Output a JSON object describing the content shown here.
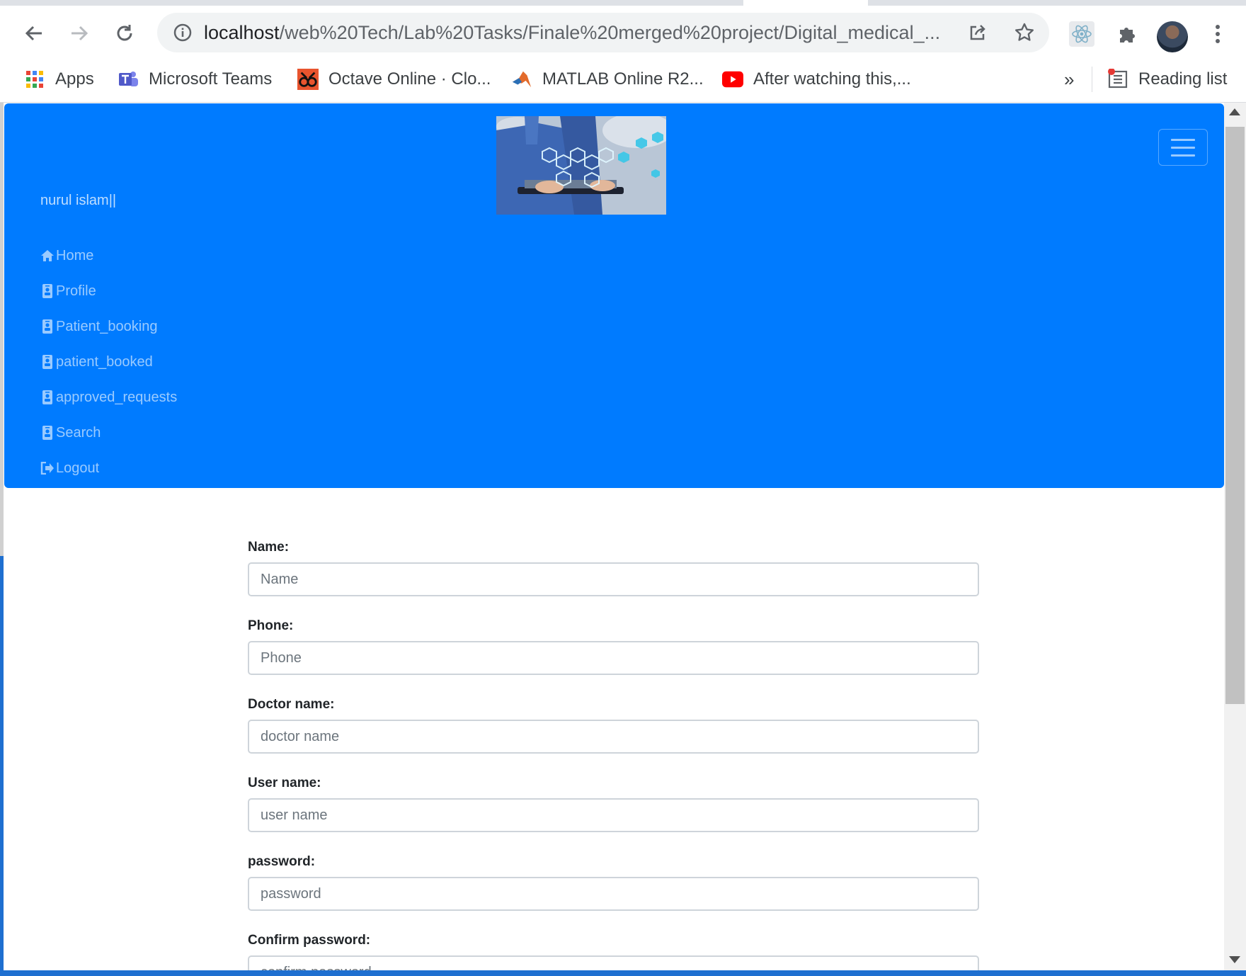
{
  "browser": {
    "url_host": "localhost",
    "url_path": "/web%20Tech/Lab%20Tasks/Finale%20merged%20project/Digital_medical_...",
    "bookmarks": [
      {
        "label": "Apps",
        "icon": "apps-grid-icon"
      },
      {
        "label": "Microsoft Teams",
        "icon": "teams-icon"
      },
      {
        "label": "Octave Online · Clo...",
        "icon": "octave-icon"
      },
      {
        "label": "MATLAB Online R2...",
        "icon": "matlab-icon"
      },
      {
        "label": "After watching this,...",
        "icon": "youtube-icon"
      }
    ],
    "overflow": "»",
    "reading_list": "Reading list"
  },
  "navbar": {
    "brand": "nurul islam||",
    "links": [
      {
        "label": "Home",
        "icon": "home-icon"
      },
      {
        "label": "Profile",
        "icon": "id-badge-icon"
      },
      {
        "label": "Patient_booking",
        "icon": "id-badge-icon"
      },
      {
        "label": "patient_booked",
        "icon": "id-badge-icon"
      },
      {
        "label": "approved_requests",
        "icon": "id-badge-icon"
      },
      {
        "label": "Search",
        "icon": "id-badge-icon"
      },
      {
        "label": "Logout",
        "icon": "sign-out-icon"
      }
    ],
    "background": "#007bff"
  },
  "form": {
    "fields": [
      {
        "label": "Name:",
        "placeholder": "Name",
        "value": ""
      },
      {
        "label": "Phone:",
        "placeholder": "Phone",
        "value": ""
      },
      {
        "label": "Doctor name:",
        "placeholder": "doctor name",
        "value": ""
      },
      {
        "label": "User name:",
        "placeholder": "user name",
        "value": ""
      },
      {
        "label": "password:",
        "placeholder": "password",
        "value": ""
      },
      {
        "label": "Confirm password:",
        "placeholder": "confirm password",
        "value": ""
      }
    ]
  }
}
